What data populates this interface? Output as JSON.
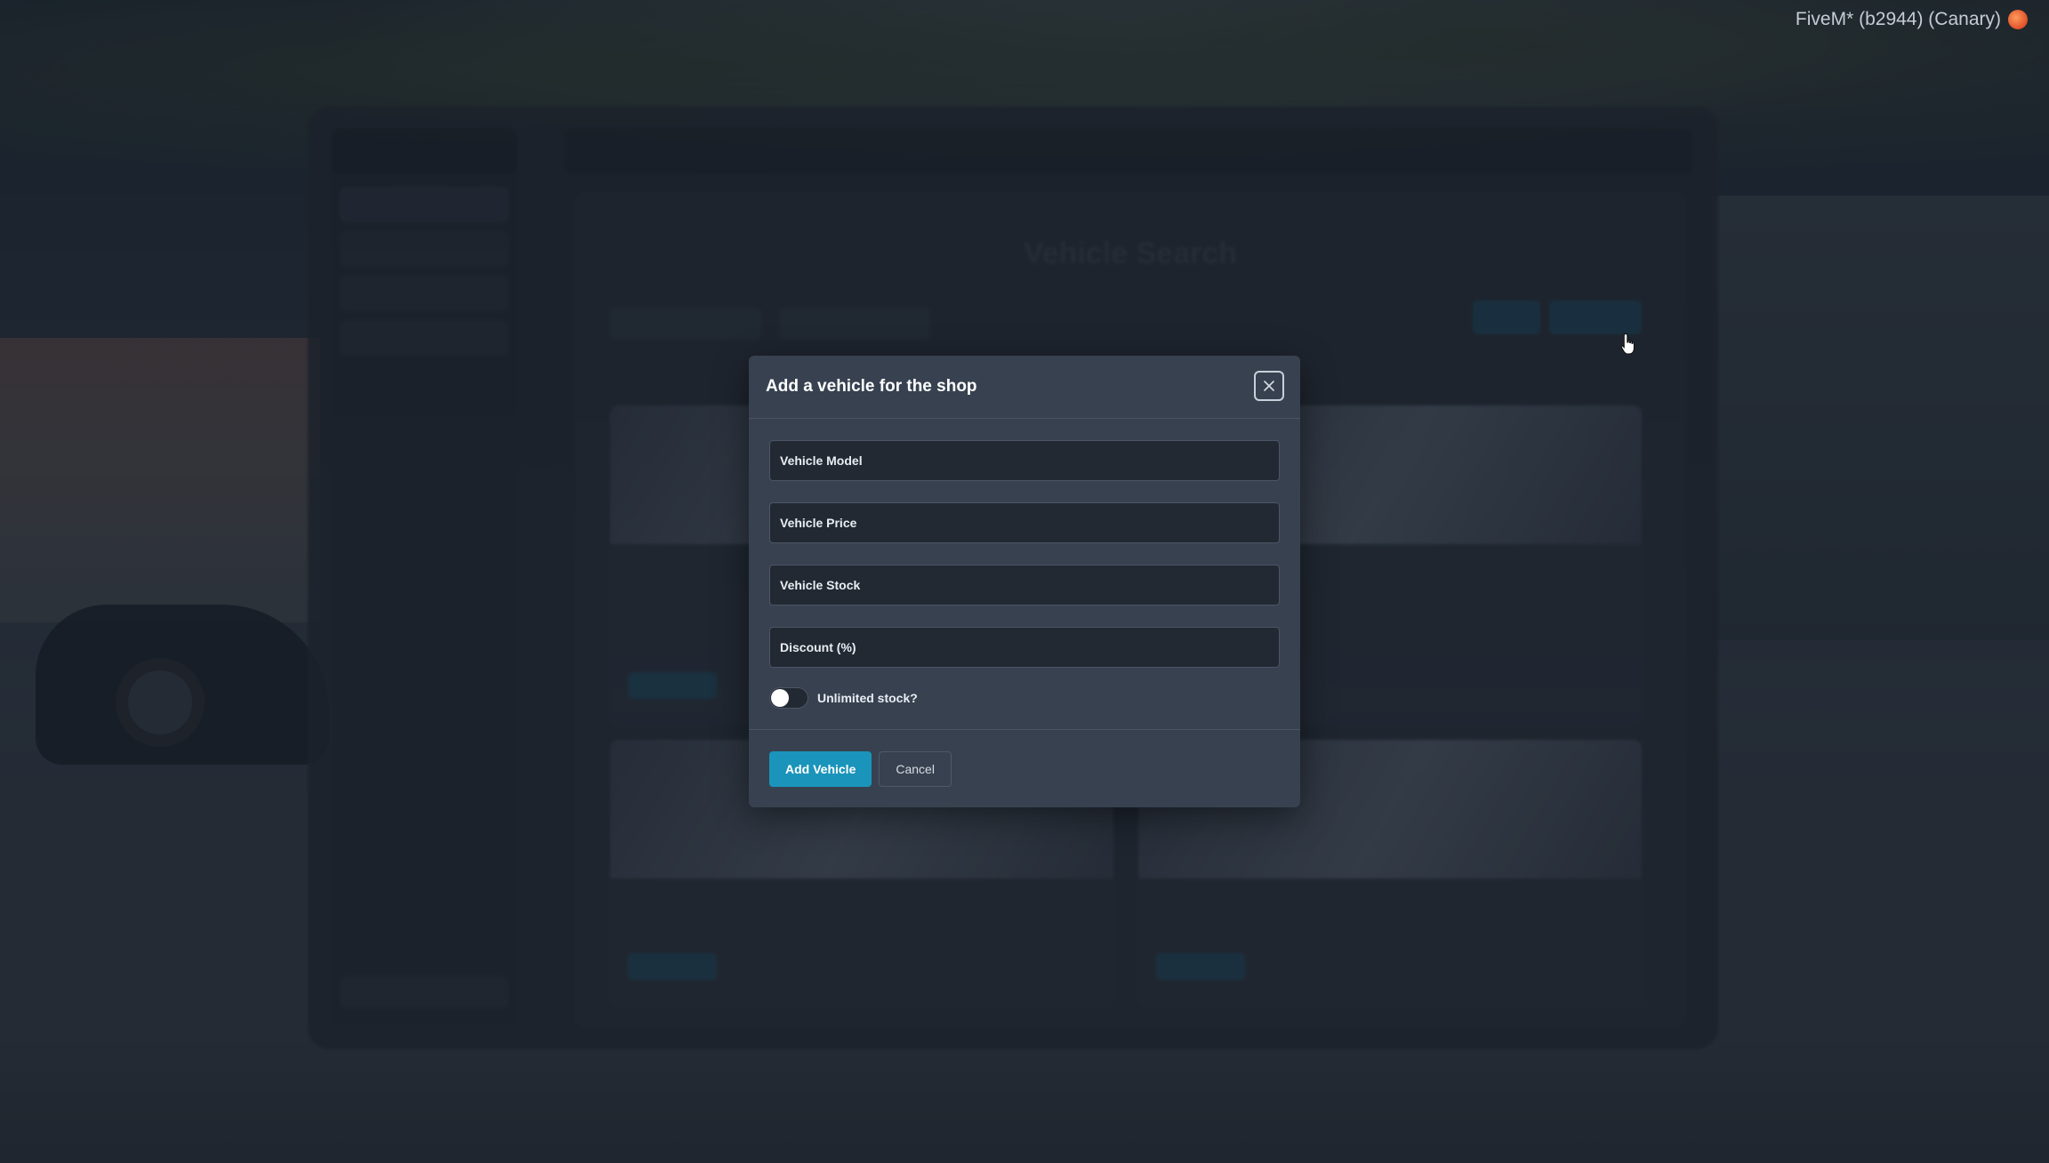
{
  "overlay": {
    "build_label": "FiveM* (b2944) (Canary)"
  },
  "modal": {
    "title": "Add a vehicle for the shop",
    "fields": [
      {
        "placeholder": "Vehicle Model",
        "value": ""
      },
      {
        "placeholder": "Vehicle Price",
        "value": ""
      },
      {
        "placeholder": "Vehicle Stock",
        "value": ""
      },
      {
        "placeholder": "Discount (%)",
        "value": ""
      }
    ],
    "unlimited_stock": {
      "label": "Unlimited stock?",
      "checked": false
    },
    "add_label": "Add Vehicle",
    "cancel_label": "Cancel"
  },
  "colors": {
    "modal_bg": "#374150",
    "input_bg": "#222933",
    "primary": "#1a94ba"
  },
  "icons": {
    "close": "close-icon",
    "cursor": "hand-pointer-icon",
    "fivem": "fivem-logo-icon"
  }
}
